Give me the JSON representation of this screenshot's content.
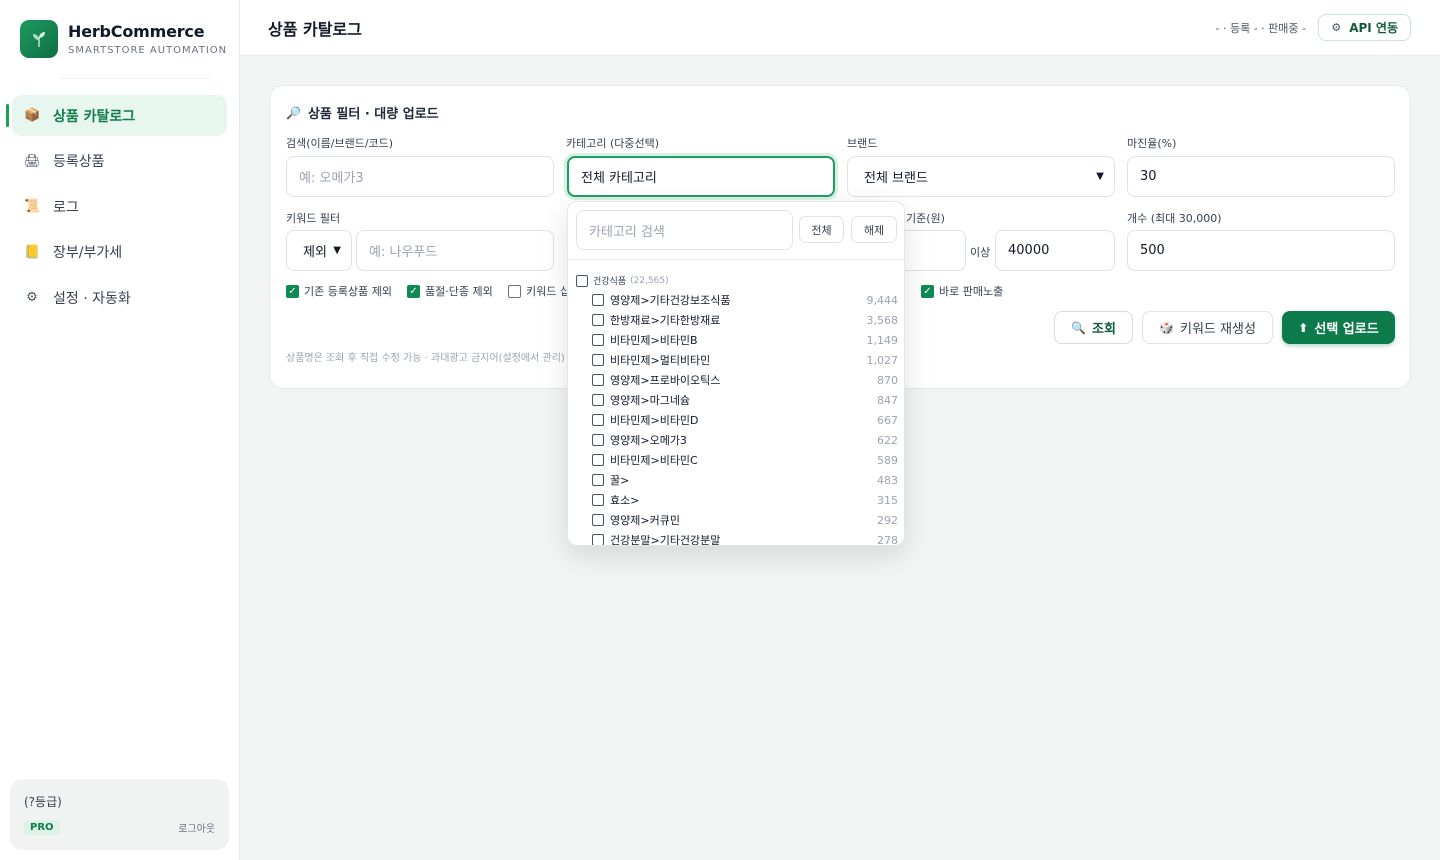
{
  "brand": {
    "name": "HerbCommerce",
    "subtitle": "SMARTSTORE AUTOMATION"
  },
  "sidebar": {
    "items": [
      {
        "icon": "📦",
        "label": "상품 카탈로그",
        "active": true
      },
      {
        "icon": "🖨",
        "label": "등록상품"
      },
      {
        "icon": "📜",
        "label": "로그"
      },
      {
        "icon": "📒",
        "label": "장부/부가세"
      },
      {
        "icon": "⚙",
        "label": "설정 · 자동화"
      }
    ],
    "account": {
      "grade": "(?등급)",
      "plan": "PRO",
      "logout": "로그아웃"
    }
  },
  "header": {
    "title": "상품 카탈로그",
    "status": "- · 등록 - · 판매중 -",
    "api_button": "API 연동",
    "api_icon": "gear-icon"
  },
  "card": {
    "title": "상품 필터 · 대량 업로드",
    "title_icon": "🔎",
    "search": {
      "label": "검색(이름/브랜드/코드)",
      "placeholder": "예: 오메가3"
    },
    "category": {
      "label": "카테고리 (다중선택)",
      "value": "전체 카테고리"
    },
    "brand": {
      "label": "브랜드",
      "value": "전체 브랜드"
    },
    "margin": {
      "label": "마진율(%)",
      "value": "30"
    },
    "keyword": {
      "label": "키워드 필터",
      "mode": "제외",
      "placeholder": "예: 나우푸드"
    },
    "price": {
      "label": "기준(원)",
      "suffix": "이상",
      "value": "40000"
    },
    "count": {
      "label": "개수 (최대 30,000)",
      "value": "500"
    },
    "checkboxes": {
      "exclude_registered": {
        "label": "기존 등록상품 제외",
        "checked": true
      },
      "exclude_soldout": {
        "label": "품절·단종 제외",
        "checked": true
      },
      "keyword_partial": {
        "label": "키워드 십",
        "checked": false
      },
      "publish_now": {
        "label": "바로 판매노출",
        "checked": true
      }
    },
    "buttons": {
      "search": "조회",
      "regen": "키워드 재생성",
      "upload": "선택 업로드"
    },
    "note": "상품명은 조회 후 직접 수정 가능 · 과대광고 금지어(설정에서 관리)"
  },
  "dropdown": {
    "search_placeholder": "카테고리 검색",
    "select_all": "전체",
    "clear": "해제",
    "group": {
      "name": "건강식품",
      "count": "(22,565)"
    },
    "items": [
      {
        "name": "영양제>기타건강보조식품",
        "count": "9,444"
      },
      {
        "name": "한방재료>기타한방재료",
        "count": "3,568"
      },
      {
        "name": "비타민제>비타민B",
        "count": "1,149"
      },
      {
        "name": "비타민제>멀티비타민",
        "count": "1,027"
      },
      {
        "name": "영양제>프로바이오틱스",
        "count": "870"
      },
      {
        "name": "영양제>마그네슘",
        "count": "847"
      },
      {
        "name": "비타민제>비타민D",
        "count": "667"
      },
      {
        "name": "영양제>오메가3",
        "count": "622"
      },
      {
        "name": "비타민제>비타민C",
        "count": "589"
      },
      {
        "name": "꿀>",
        "count": "483"
      },
      {
        "name": "효소>",
        "count": "315"
      },
      {
        "name": "영양제>커큐민",
        "count": "292"
      },
      {
        "name": "건강분말>기타건강분말",
        "count": "278"
      }
    ]
  }
}
